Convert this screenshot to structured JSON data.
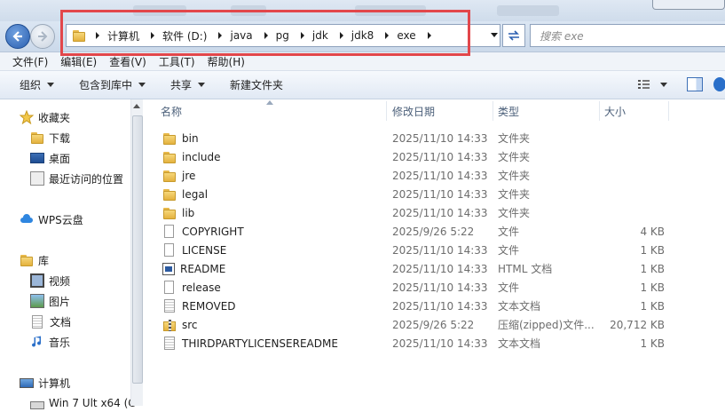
{
  "address": {
    "crumbs": [
      "计算机",
      "软件 (D:)",
      "java",
      "pg",
      "jdk",
      "jdk8",
      "exe"
    ],
    "search_placeholder": "搜索 exe"
  },
  "menu": [
    "文件(F)",
    "编辑(E)",
    "查看(V)",
    "工具(T)",
    "帮助(H)"
  ],
  "toolbar": {
    "organize": "组织",
    "include_library": "包含到库中",
    "share": "共享",
    "new_folder": "新建文件夹"
  },
  "nav": {
    "favorites": "收藏夹",
    "downloads": "下载",
    "desktop": "桌面",
    "recent": "最近访问的位置",
    "wps": "WPS云盘",
    "libraries": "库",
    "videos": "视频",
    "pictures": "图片",
    "documents": "文档",
    "music": "音乐",
    "computer": "计算机",
    "win7": "Win 7 Ult x64 (C"
  },
  "columns": {
    "name": "名称",
    "modified": "修改日期",
    "type": "类型",
    "size": "大小"
  },
  "files": [
    {
      "name": "bin",
      "date": "2025/11/10 14:33",
      "type": "文件夹",
      "size": "",
      "icon": "folder"
    },
    {
      "name": "include",
      "date": "2025/11/10 14:33",
      "type": "文件夹",
      "size": "",
      "icon": "folder"
    },
    {
      "name": "jre",
      "date": "2025/11/10 14:33",
      "type": "文件夹",
      "size": "",
      "icon": "folder"
    },
    {
      "name": "legal",
      "date": "2025/11/10 14:33",
      "type": "文件夹",
      "size": "",
      "icon": "folder"
    },
    {
      "name": "lib",
      "date": "2025/11/10 14:33",
      "type": "文件夹",
      "size": "",
      "icon": "folder"
    },
    {
      "name": "COPYRIGHT",
      "date": "2025/9/26 5:22",
      "type": "文件",
      "size": "4 KB",
      "icon": "file"
    },
    {
      "name": "LICENSE",
      "date": "2025/11/10 14:33",
      "type": "文件",
      "size": "1 KB",
      "icon": "file"
    },
    {
      "name": "README",
      "date": "2025/11/10 14:33",
      "type": "HTML 文档",
      "size": "1 KB",
      "icon": "html"
    },
    {
      "name": "release",
      "date": "2025/11/10 14:33",
      "type": "文件",
      "size": "1 KB",
      "icon": "file"
    },
    {
      "name": "REMOVED",
      "date": "2025/11/10 14:33",
      "type": "文本文档",
      "size": "1 KB",
      "icon": "text"
    },
    {
      "name": "src",
      "date": "2025/9/26 5:22",
      "type": "压缩(zipped)文件...",
      "size": "20,712 KB",
      "icon": "zip"
    },
    {
      "name": "THIRDPARTYLICENSEREADME",
      "date": "2025/11/10 14:33",
      "type": "文本文档",
      "size": "1 KB",
      "icon": "text"
    }
  ],
  "colors": {
    "highlight": "#e2474b",
    "accent": "#2a5fb0"
  }
}
